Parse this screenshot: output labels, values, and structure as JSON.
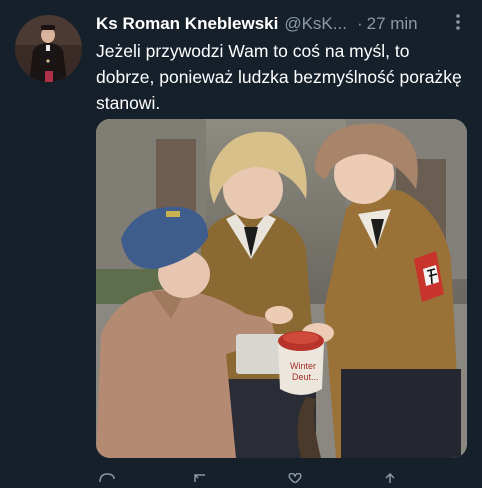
{
  "tweet": {
    "author_name": "Ks Roman Kneblewski",
    "handle": "@KsK...",
    "separator": "·",
    "time": "27 min",
    "text": "Jeżeli przywodzi Wam to coś na myśl, to dobrze, ponieważ ludzka bezmyślność porażkę stanowi.",
    "media": {
      "box_label_line1": "Winter",
      "box_label_line2": "Deut..."
    }
  },
  "icons": {
    "more": "more-vertical-icon",
    "reply": "reply-icon",
    "retweet": "retweet-icon",
    "like": "like-icon",
    "share": "share-icon"
  },
  "colors": {
    "background": "#15202b",
    "text": "#ffffff",
    "secondary_text": "#8b98a5"
  }
}
